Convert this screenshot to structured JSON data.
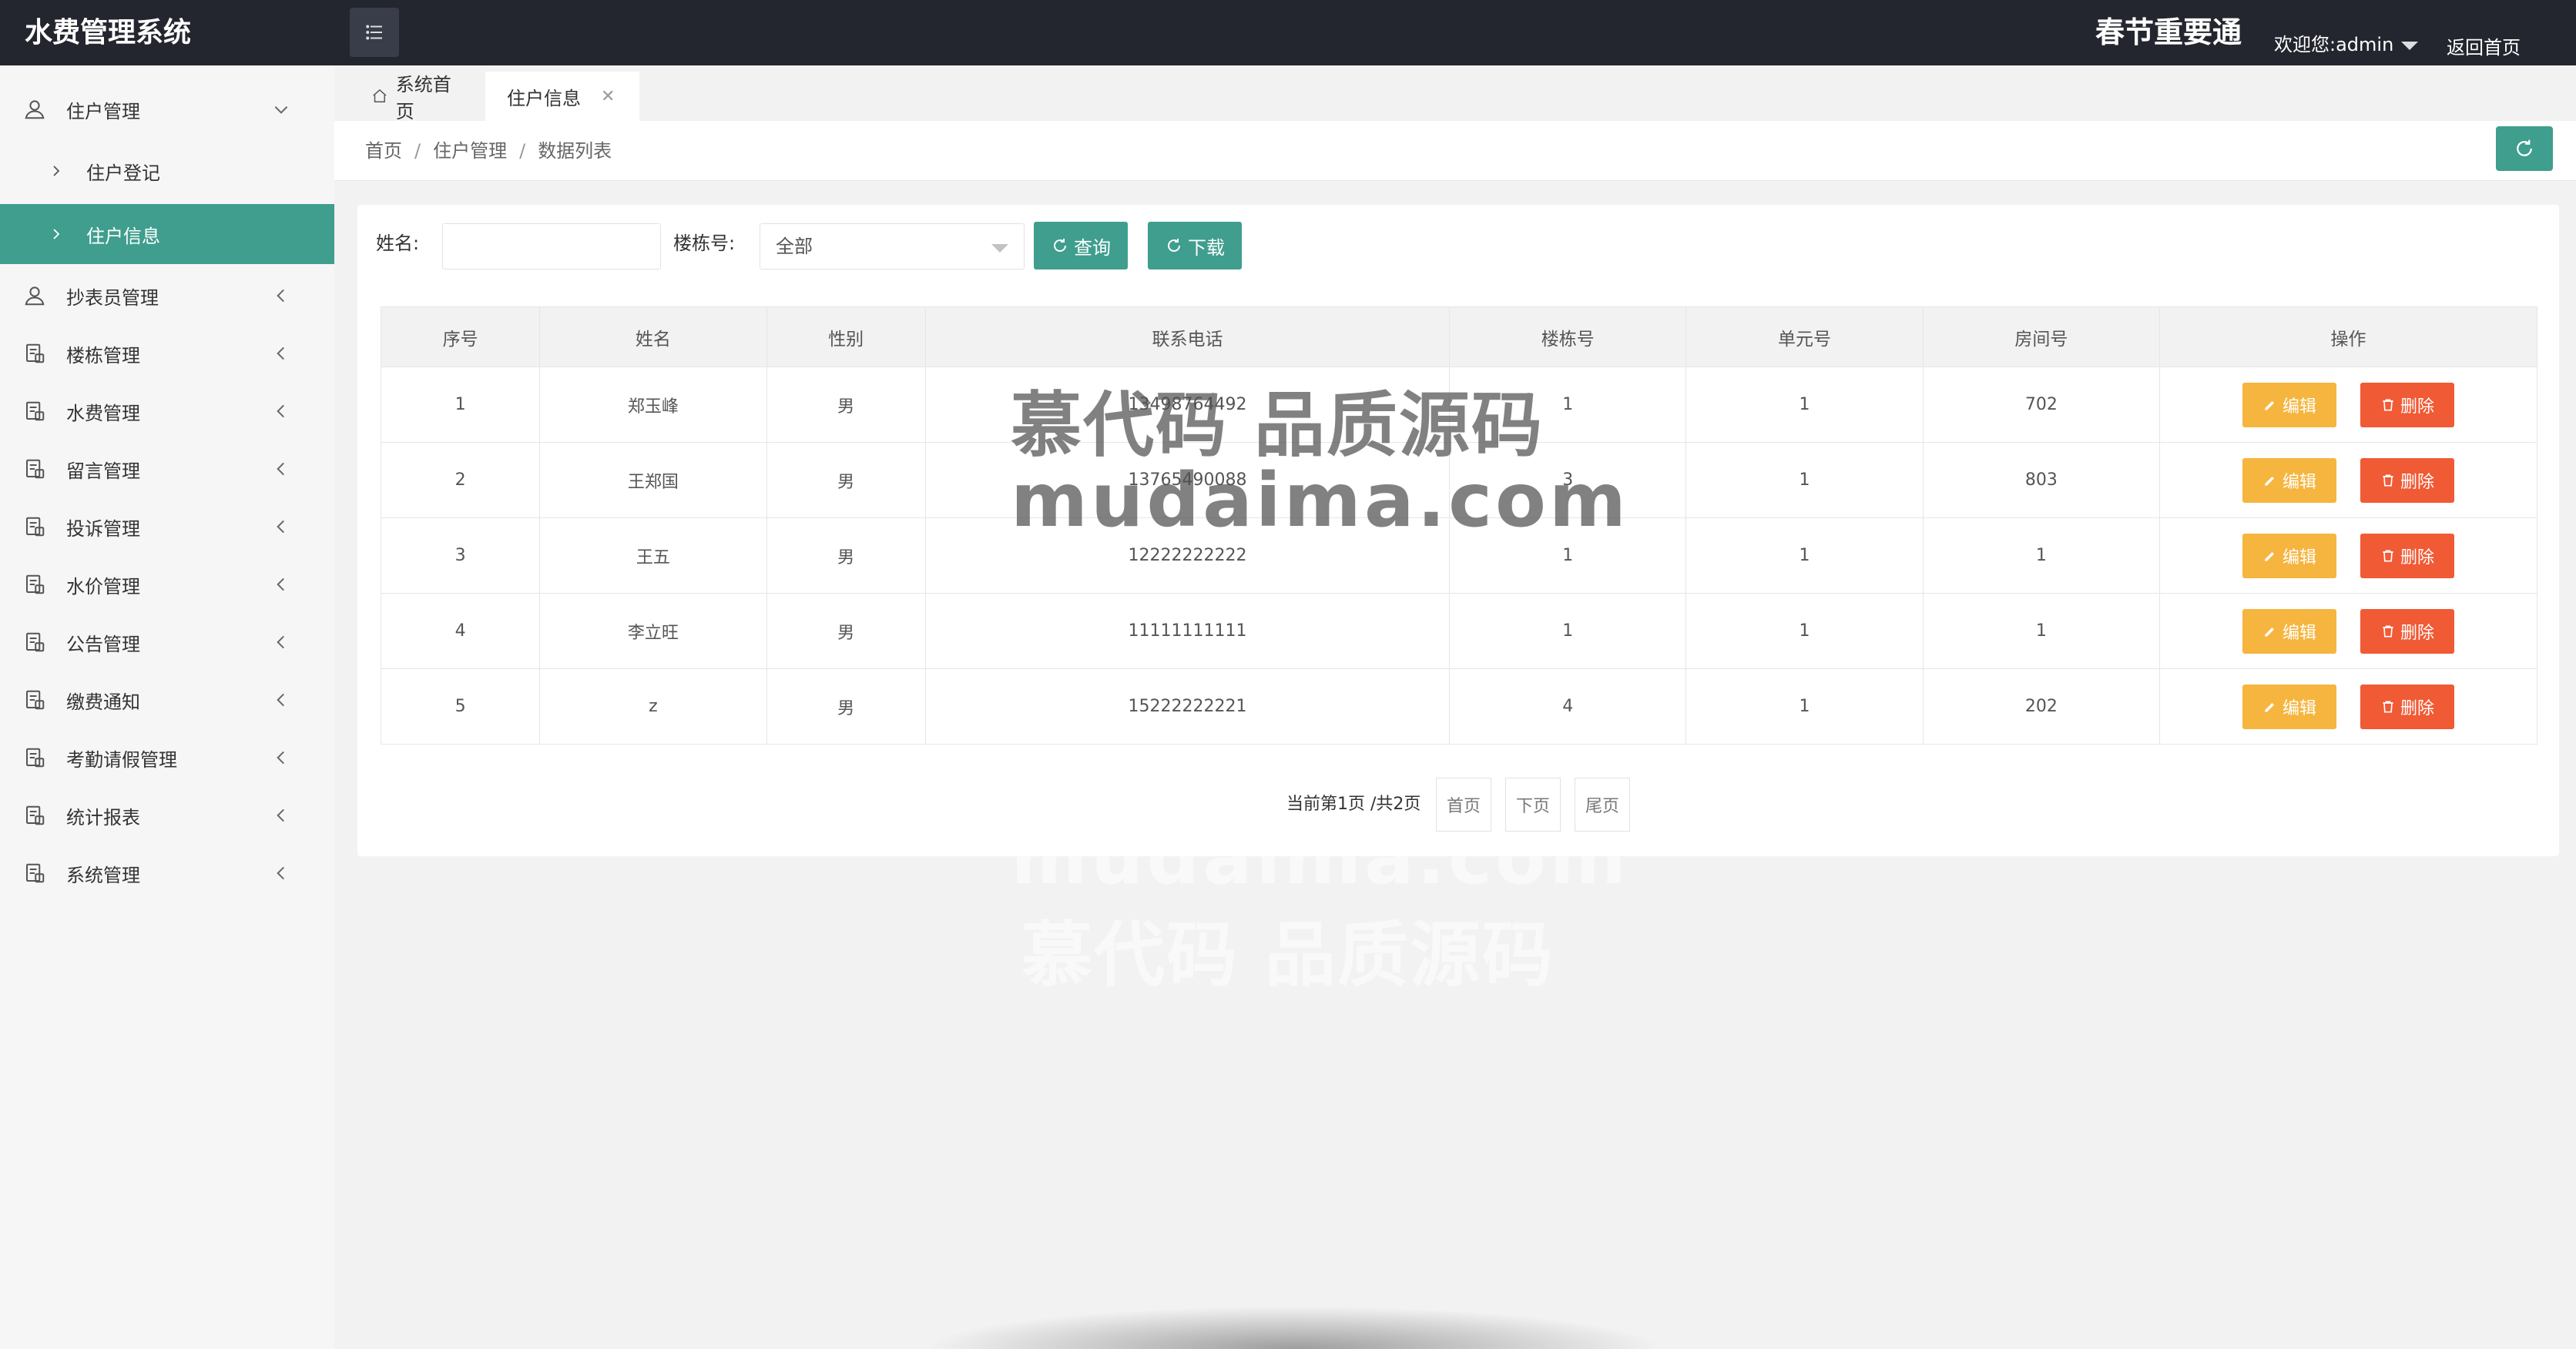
{
  "header": {
    "brand": "水费管理系统",
    "notice": "春节重要通",
    "welcome": "欢迎您:admin",
    "home_link": "返回首页"
  },
  "sidebar": {
    "group_open": {
      "label": "住户管理",
      "icon": "user-icon"
    },
    "sub_items": [
      {
        "label": "住户登记"
      },
      {
        "label": "住户信息",
        "active": true
      }
    ],
    "groups": [
      {
        "label": "抄表员管理",
        "icon": "user-icon"
      },
      {
        "label": "楼栋管理",
        "icon": "document-icon"
      },
      {
        "label": "水费管理",
        "icon": "document-icon"
      },
      {
        "label": "留言管理",
        "icon": "document-icon"
      },
      {
        "label": "投诉管理",
        "icon": "document-icon"
      },
      {
        "label": "水价管理",
        "icon": "document-icon"
      },
      {
        "label": "公告管理",
        "icon": "document-icon"
      },
      {
        "label": "缴费通知",
        "icon": "document-icon"
      },
      {
        "label": "考勤请假管理",
        "icon": "document-icon"
      },
      {
        "label": "统计报表",
        "icon": "document-icon"
      },
      {
        "label": "系统管理",
        "icon": "document-icon"
      }
    ]
  },
  "tabs": [
    {
      "label": "系统首页"
    },
    {
      "label": "住户信息"
    }
  ],
  "breadcrumb": [
    "首页",
    "住户管理",
    "数据列表"
  ],
  "filters": {
    "name_label": "姓名:",
    "name_value": "",
    "building_label": "楼栋号:",
    "building_value": "全部",
    "search_label": "查询",
    "download_label": "下载"
  },
  "table": {
    "columns": [
      "序号",
      "姓名",
      "性别",
      "联系电话",
      "楼栋号",
      "单元号",
      "房间号",
      "操作"
    ],
    "rows": [
      [
        "1",
        "郑玉峰",
        "男",
        "13498764492",
        "1",
        "1",
        "702"
      ],
      [
        "2",
        "王郑国",
        "男",
        "13765490088",
        "3",
        "1",
        "803"
      ],
      [
        "3",
        "王五",
        "男",
        "12222222222",
        "1",
        "1",
        "1"
      ],
      [
        "4",
        "李立旺",
        "男",
        "11111111111",
        "1",
        "1",
        "1"
      ],
      [
        "5",
        "z",
        "男",
        "15222222221",
        "4",
        "1",
        "202"
      ]
    ],
    "edit_label": "编辑",
    "delete_label": "删除"
  },
  "pagination": {
    "info": "当前第1页 /共2页",
    "first": "首页",
    "next": "下页",
    "last": "尾页"
  },
  "watermark": {
    "cn": "慕代码 品质源码",
    "en": "mudaima.com"
  },
  "colors": {
    "header_bg": "#23262e",
    "accent": "#3f9e8e",
    "edit": "#f6b53f",
    "delete": "#f05a35"
  }
}
